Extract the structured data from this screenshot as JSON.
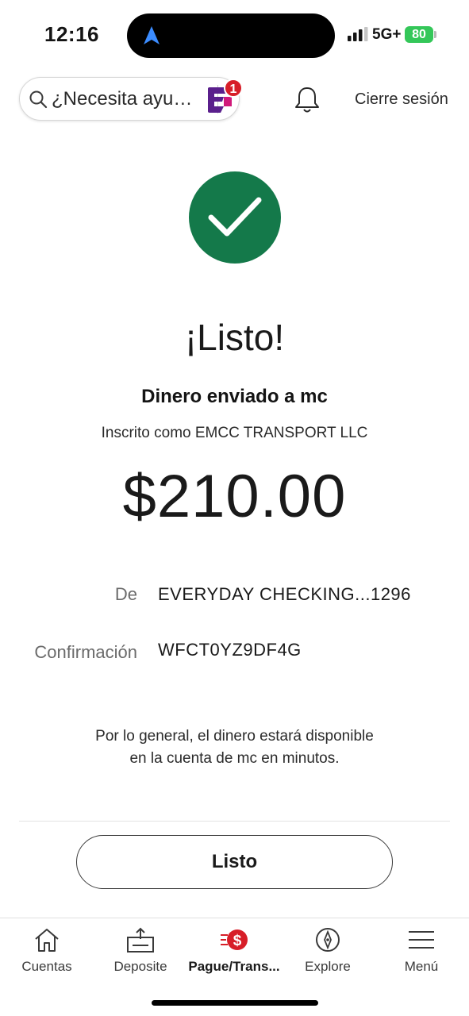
{
  "status_bar": {
    "time": "12:16",
    "network": "5G+",
    "battery": "80"
  },
  "header": {
    "search_placeholder": "¿Necesita ayu…",
    "notification_count": "1",
    "sign_out": "Cierre sesión"
  },
  "confirmation": {
    "title": "¡Listo!",
    "subtitle": "Dinero enviado a mc",
    "enrolled_as": "Inscrito como EMCC TRANSPORT LLC",
    "amount": "$210.00",
    "details": {
      "from_label": "De",
      "from_value": "EVERYDAY CHECKING...1296",
      "confirmation_label": "Confirmación",
      "confirmation_value": "WFCT0YZ9DF4G"
    },
    "note_line1": "Por lo general, el dinero estará disponible",
    "note_line2": "en la cuenta de mc en minutos.",
    "done_button": "Listo"
  },
  "tabbar": {
    "items": [
      {
        "label": "Cuentas",
        "icon": "home-icon"
      },
      {
        "label": "Deposite",
        "icon": "deposit-icon"
      },
      {
        "label": "Pague/Trans...",
        "icon": "pay-transfer-icon",
        "active": true
      },
      {
        "label": "Explore",
        "icon": "compass-icon"
      },
      {
        "label": "Menú",
        "icon": "menu-icon"
      }
    ]
  },
  "colors": {
    "success_green": "#14794a",
    "accent_red": "#d71e28",
    "fargo_purple": "#5a1f8c"
  }
}
